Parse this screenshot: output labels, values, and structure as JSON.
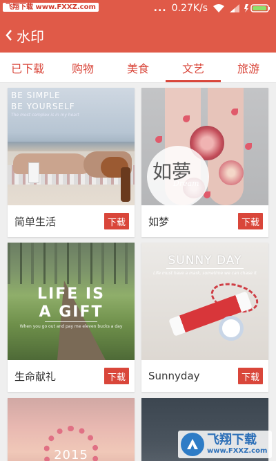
{
  "status_bar": {
    "watermark_top": "飞翔下载 www.FXXZ.com",
    "dots": "...",
    "speed": "0.27K/s",
    "bg_color": "#e05a48"
  },
  "app_bar": {
    "back_icon": "chevron-left-icon",
    "title": "水印"
  },
  "tabs": {
    "items": [
      {
        "label": "已下载"
      },
      {
        "label": "购物"
      },
      {
        "label": "美食"
      },
      {
        "label": "文艺",
        "active": true
      },
      {
        "label": "旅游"
      }
    ],
    "active_color": "#d9463a"
  },
  "cards": [
    {
      "name": "简单生活",
      "button": "下载",
      "overlay": {
        "line1": "BE SIMPLE",
        "line2": "BE YOURSELF",
        "line3": "The most complex is in my heart"
      }
    },
    {
      "name": "如梦",
      "button": "下载",
      "overlay": {
        "line1": "如夢",
        "line2": "Dream"
      }
    },
    {
      "name": "生命献礼",
      "button": "下载",
      "overlay": {
        "line1": "LIFE IS",
        "line2": "A GIFT",
        "line3": "When you go out and pay me eleven bucks a day"
      }
    },
    {
      "name": "Sunnyday",
      "button": "下载",
      "overlay": {
        "line1": "SUNNY DAY",
        "line2": "Life must have a mark, sometime we can chase it"
      }
    },
    {
      "overlay": {
        "line1": "2015"
      }
    },
    {}
  ],
  "watermark_bottom": {
    "brand": "飞翔下载",
    "url": "www.FXXZ.com",
    "logo_icon": "fxxz-logo-icon"
  }
}
